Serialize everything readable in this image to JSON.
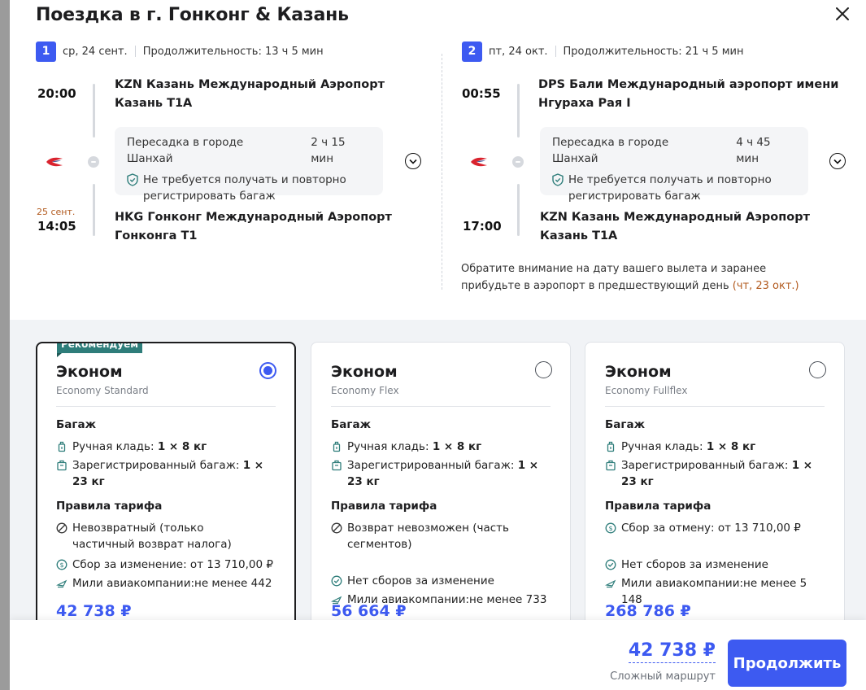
{
  "modal": {
    "title": "Поездка в г. Гонконг & Казань"
  },
  "segments": [
    {
      "num": "1",
      "date": "ср, 24 сент.",
      "duration": "Продолжительность: 13 ч 5 мин",
      "dep_time": "20:00",
      "dep_airport_line1": "KZN Казань Международный Аэропорт",
      "dep_airport_line2": "Казань T1A",
      "layover_city": "Пересадка в городе Шанхай",
      "layover_time": "2 ч 15 мин",
      "baggage_note": "Не требуется получать и повторно регистрировать багаж",
      "arr_date": "25 сент.",
      "arr_time": "14:05",
      "arr_airport_line1": "HKG Гонконг Международный Аэропорт",
      "arr_airport_line2": "Гонконга T1"
    },
    {
      "num": "2",
      "date": "пт, 24 окт.",
      "duration": "Продолжительность: 21 ч 5 мин",
      "dep_time": "00:55",
      "dep_airport_line1": "DPS Бали Международный аэропорт имени",
      "dep_airport_line2": "Нгураха Рая I",
      "layover_city": "Пересадка в городе Шанхай",
      "layover_time": "4 ч 45 мин",
      "baggage_note": "Не требуется получать и повторно регистрировать багаж",
      "arr_time": "17:00",
      "arr_airport_line1": "KZN Казань Международный Аэропорт",
      "arr_airport_line2": "Казань T1A",
      "notice_text": "Обратите внимание на дату вашего вылета и заранее прибудьте в аэропорт в предшествующий день",
      "notice_date": "(чт, 23 окт.)"
    }
  ],
  "fares": [
    {
      "badge": "Рекомендуем",
      "name": "Эконом",
      "sub": "Economy Standard",
      "baggage_title": "Багаж",
      "hand_label": "Ручная кладь:",
      "hand_value": "1 × 8 кг",
      "checked_label": "Зарегистрированный багаж:",
      "checked_value": "1 × 23 кг",
      "rules_title": "Правила тарифа",
      "refund": "Невозвратный (только частичный возврат налога)",
      "change": "Сбор за изменение: от 13 710,00 ₽",
      "miles": "Мили авиакомпании:не менее 442",
      "price": "42 738 ₽",
      "selected": true
    },
    {
      "name": "Эконом",
      "sub": "Economy Flex",
      "baggage_title": "Багаж",
      "hand_label": "Ручная кладь:",
      "hand_value": "1 × 8 кг",
      "checked_label": "Зарегистрированный багаж:",
      "checked_value": "1 × 23 кг",
      "rules_title": "Правила тарифа",
      "refund": "Возврат невозможен (часть сегментов)",
      "change": "Нет сборов за изменение",
      "miles": "Мили авиакомпании:не менее 733",
      "price": "56 664 ₽",
      "selected": false
    },
    {
      "name": "Эконом",
      "sub": "Economy Fullflex",
      "baggage_title": "Багаж",
      "hand_label": "Ручная кладь:",
      "hand_value": "1 × 8 кг",
      "checked_label": "Зарегистрированный багаж:",
      "checked_value": "1 × 23 кг",
      "rules_title": "Правила тарифа",
      "refund": "Сбор за отмену: от 13 710,00 ₽",
      "change": "Нет сборов за изменение",
      "miles": "Мили авиакомпании:не менее 5 148",
      "price": "268 786 ₽",
      "selected": false
    }
  ],
  "footer": {
    "total": "42 738 ₽",
    "total_sub": "Сложный маршрут",
    "cta": "Продолжить"
  },
  "colors": {
    "accent": "#3d5af1",
    "badge": "#2e7d7a",
    "warning_text": "#b25a1e"
  }
}
